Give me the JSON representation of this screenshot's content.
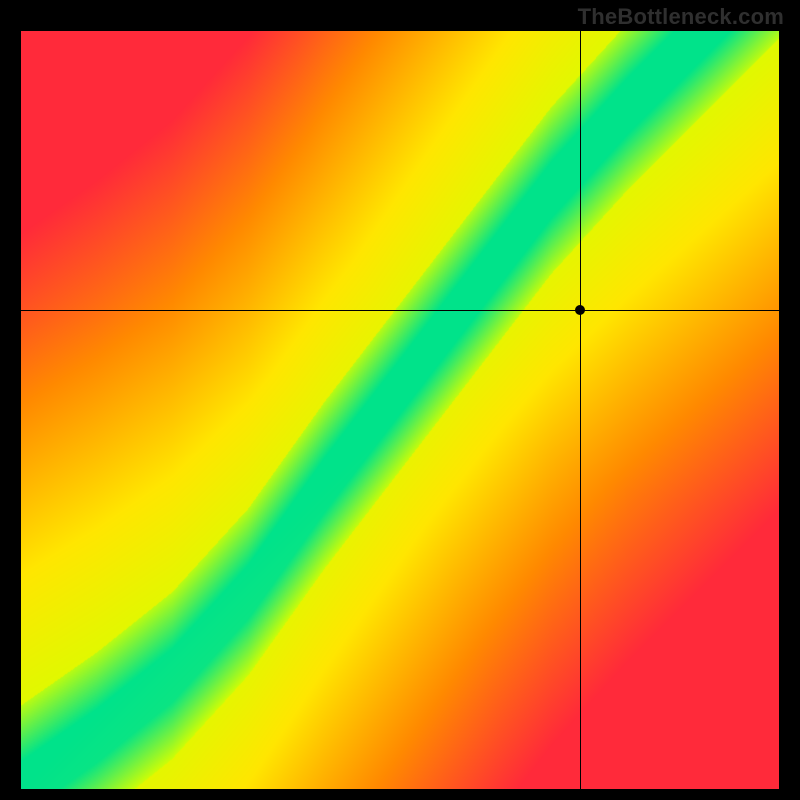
{
  "watermark": "TheBottleneck.com",
  "chart_data": {
    "type": "heatmap",
    "title": "",
    "xlabel": "",
    "ylabel": "",
    "xlim": [
      0,
      1
    ],
    "ylim": [
      0,
      1
    ],
    "grid": false,
    "colorscale": [
      "#ff2a3a",
      "#ff8a00",
      "#ffe600",
      "#d6ff00",
      "#00e38a"
    ],
    "crosshair": {
      "x": 0.738,
      "y": 0.632
    },
    "marker": {
      "x": 0.738,
      "y": 0.632
    },
    "ideal_curve": {
      "description": "green ridge where GPU/CPU are balanced",
      "points": [
        {
          "x": 0.0,
          "y": 0.0
        },
        {
          "x": 0.1,
          "y": 0.07
        },
        {
          "x": 0.2,
          "y": 0.15
        },
        {
          "x": 0.3,
          "y": 0.26
        },
        {
          "x": 0.4,
          "y": 0.4
        },
        {
          "x": 0.5,
          "y": 0.53
        },
        {
          "x": 0.6,
          "y": 0.66
        },
        {
          "x": 0.7,
          "y": 0.79
        },
        {
          "x": 0.8,
          "y": 0.9
        },
        {
          "x": 0.9,
          "y": 1.0
        }
      ]
    },
    "band_half_width": 0.035,
    "band_soft_width": 0.075
  }
}
